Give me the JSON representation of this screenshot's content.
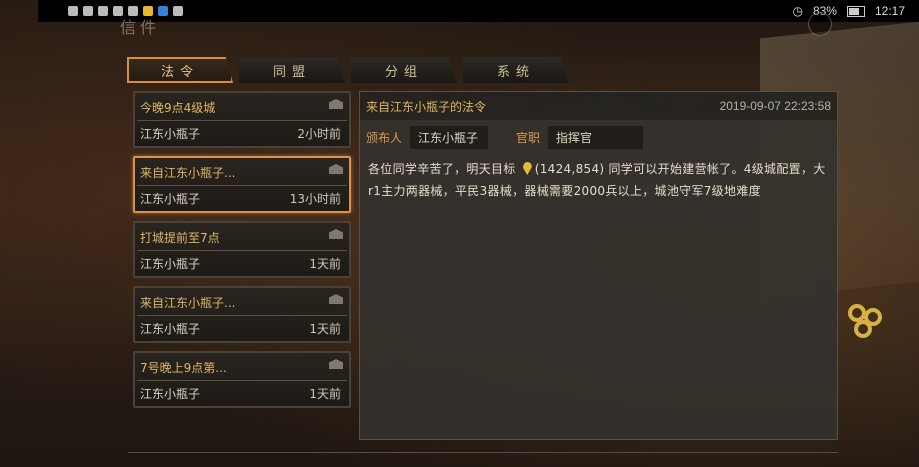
{
  "status_bar": {
    "battery": "83%",
    "time": "12:17"
  },
  "header": {
    "title": "信件"
  },
  "tabs": [
    {
      "label": "法令",
      "active": true
    },
    {
      "label": "同盟",
      "active": false
    },
    {
      "label": "分组",
      "active": false
    },
    {
      "label": "系统",
      "active": false
    }
  ],
  "messages": [
    {
      "title": "今晚9点4级城",
      "sender": "江东小瓶子",
      "time": "2小时前"
    },
    {
      "title": "来自江东小瓶子...",
      "sender": "江东小瓶子",
      "time": "13小时前"
    },
    {
      "title": "打城提前至7点",
      "sender": "江东小瓶子",
      "time": "1天前"
    },
    {
      "title": "来自江东小瓶子...",
      "sender": "江东小瓶子",
      "time": "1天前"
    },
    {
      "title": "7号晚上9点第...",
      "sender": "江东小瓶子",
      "time": "1天前"
    }
  ],
  "detail": {
    "title": "来自江东小瓶子的法令",
    "date": "2019-09-07 22:23:58",
    "issuer_label": "颁布人",
    "issuer": "江东小瓶子",
    "rank_label": "官职",
    "rank": "指挥官",
    "body_before": "各位同学辛苦了，明天目标",
    "coords": "(1424,854)",
    "body_after": "同学可以开始建营帐了。4级城配置，大r1主力两器械，平民3器械，器械需要2000兵以上，城池守军7级地难度"
  },
  "colors": {
    "accent": "#d8924a",
    "title_gold": "#e0b667",
    "pin": "#e7bb35"
  }
}
